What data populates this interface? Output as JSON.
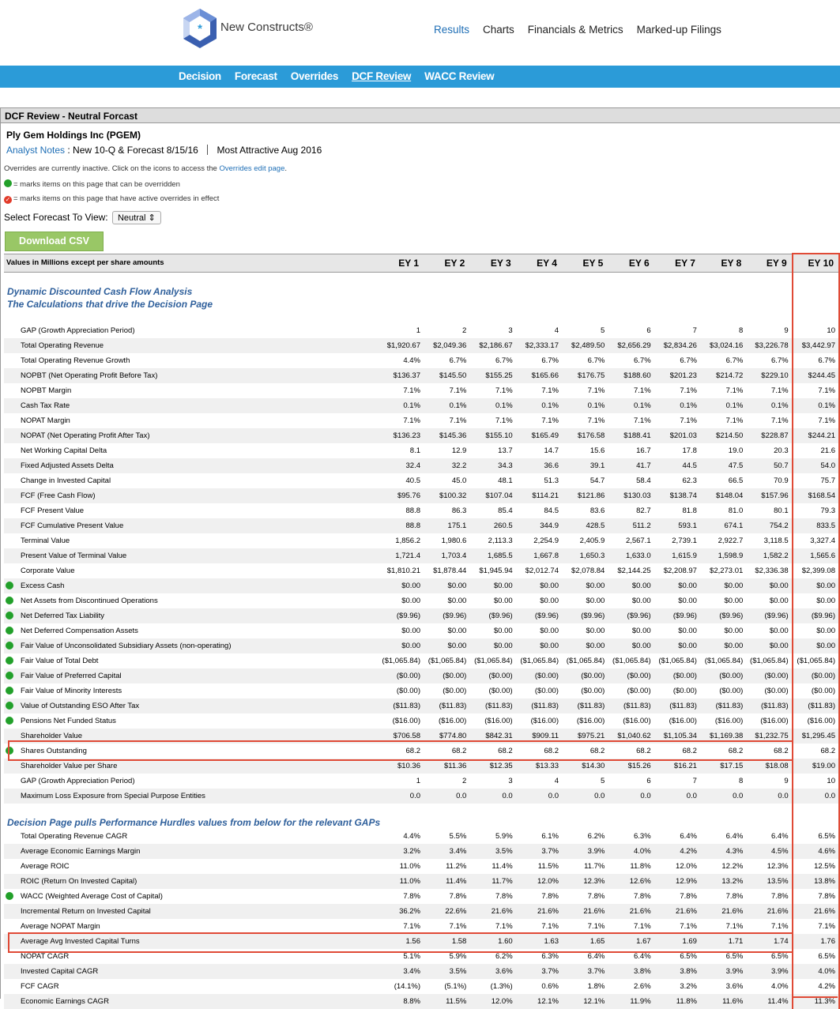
{
  "brand": {
    "name": "New Constructs®"
  },
  "topnav": [
    "Results",
    "Charts",
    "Financials & Metrics",
    "Marked-up Filings"
  ],
  "subnav": [
    "Decision",
    "Forecast",
    "Overrides",
    "DCF Review",
    "WACC Review"
  ],
  "panel": {
    "title": "DCF Review - Neutral Forcast",
    "company": "Ply Gem Holdings Inc (PGEM)",
    "notes_link": "Analyst Notes",
    "notes_text": ": New 10-Q & Forecast 8/15/16",
    "notes_right": "Most Attractive Aug 2016",
    "overrides_prefix": "Overrides are currently inactive. Click on the icons to access the ",
    "overrides_link": "Overrides edit page",
    "legend_green": "= marks items on this page that can be overridden",
    "legend_red": "= marks items on this page that have active overrides in effect",
    "select_label": "Select Forecast To View:",
    "select_value": "Neutral",
    "csv_button": "Download CSV"
  },
  "table": {
    "header": "Values in Millions except per share amounts",
    "columns": [
      "EY 1",
      "EY 2",
      "EY 3",
      "EY 4",
      "EY 5",
      "EY 6",
      "EY 7",
      "EY 8",
      "EY 9",
      "EY 10"
    ],
    "section1": [
      "Dynamic Discounted Cash Flow Analysis",
      "The Calculations that drive the Decision Page"
    ],
    "section2": "Decision Page pulls Performance Hurdles values from below for the relevant GAPs",
    "rows1": [
      {
        "label": "GAP (Growth Appreciation Period)",
        "dot": false,
        "values": [
          "1",
          "2",
          "3",
          "4",
          "5",
          "6",
          "7",
          "8",
          "9",
          "10"
        ]
      },
      {
        "label": "Total Operating Revenue",
        "dot": false,
        "values": [
          "$1,920.67",
          "$2,049.36",
          "$2,186.67",
          "$2,333.17",
          "$2,489.50",
          "$2,656.29",
          "$2,834.26",
          "$3,024.16",
          "$3,226.78",
          "$3,442.97"
        ]
      },
      {
        "label": "Total Operating Revenue Growth",
        "dot": false,
        "values": [
          "4.4%",
          "6.7%",
          "6.7%",
          "6.7%",
          "6.7%",
          "6.7%",
          "6.7%",
          "6.7%",
          "6.7%",
          "6.7%"
        ]
      },
      {
        "label": "NOPBT (Net Operating Profit Before Tax)",
        "dot": false,
        "values": [
          "$136.37",
          "$145.50",
          "$155.25",
          "$165.66",
          "$176.75",
          "$188.60",
          "$201.23",
          "$214.72",
          "$229.10",
          "$244.45"
        ]
      },
      {
        "label": "NOPBT Margin",
        "dot": false,
        "values": [
          "7.1%",
          "7.1%",
          "7.1%",
          "7.1%",
          "7.1%",
          "7.1%",
          "7.1%",
          "7.1%",
          "7.1%",
          "7.1%"
        ]
      },
      {
        "label": "Cash Tax Rate",
        "dot": false,
        "values": [
          "0.1%",
          "0.1%",
          "0.1%",
          "0.1%",
          "0.1%",
          "0.1%",
          "0.1%",
          "0.1%",
          "0.1%",
          "0.1%"
        ]
      },
      {
        "label": "NOPAT Margin",
        "dot": false,
        "values": [
          "7.1%",
          "7.1%",
          "7.1%",
          "7.1%",
          "7.1%",
          "7.1%",
          "7.1%",
          "7.1%",
          "7.1%",
          "7.1%"
        ]
      },
      {
        "label": "NOPAT (Net Operating Profit After Tax)",
        "dot": false,
        "values": [
          "$136.23",
          "$145.36",
          "$155.10",
          "$165.49",
          "$176.58",
          "$188.41",
          "$201.03",
          "$214.50",
          "$228.87",
          "$244.21"
        ]
      },
      {
        "label": "Net Working Capital Delta",
        "dot": false,
        "values": [
          "8.1",
          "12.9",
          "13.7",
          "14.7",
          "15.6",
          "16.7",
          "17.8",
          "19.0",
          "20.3",
          "21.6"
        ]
      },
      {
        "label": "Fixed Adjusted Assets Delta",
        "dot": false,
        "values": [
          "32.4",
          "32.2",
          "34.3",
          "36.6",
          "39.1",
          "41.7",
          "44.5",
          "47.5",
          "50.7",
          "54.0"
        ]
      },
      {
        "label": "Change in Invested Capital",
        "dot": false,
        "values": [
          "40.5",
          "45.0",
          "48.1",
          "51.3",
          "54.7",
          "58.4",
          "62.3",
          "66.5",
          "70.9",
          "75.7"
        ]
      },
      {
        "label": "FCF (Free Cash Flow)",
        "dot": false,
        "values": [
          "$95.76",
          "$100.32",
          "$107.04",
          "$114.21",
          "$121.86",
          "$130.03",
          "$138.74",
          "$148.04",
          "$157.96",
          "$168.54"
        ]
      },
      {
        "label": "FCF Present Value",
        "dot": false,
        "values": [
          "88.8",
          "86.3",
          "85.4",
          "84.5",
          "83.6",
          "82.7",
          "81.8",
          "81.0",
          "80.1",
          "79.3"
        ]
      },
      {
        "label": "FCF Cumulative Present Value",
        "dot": false,
        "values": [
          "88.8",
          "175.1",
          "260.5",
          "344.9",
          "428.5",
          "511.2",
          "593.1",
          "674.1",
          "754.2",
          "833.5"
        ]
      },
      {
        "label": "Terminal Value",
        "dot": false,
        "values": [
          "1,856.2",
          "1,980.6",
          "2,113.3",
          "2,254.9",
          "2,405.9",
          "2,567.1",
          "2,739.1",
          "2,922.7",
          "3,118.5",
          "3,327.4"
        ]
      },
      {
        "label": "Present Value of Terminal Value",
        "dot": false,
        "values": [
          "1,721.4",
          "1,703.4",
          "1,685.5",
          "1,667.8",
          "1,650.3",
          "1,633.0",
          "1,615.9",
          "1,598.9",
          "1,582.2",
          "1,565.6"
        ]
      },
      {
        "label": "Corporate Value",
        "dot": false,
        "values": [
          "$1,810.21",
          "$1,878.44",
          "$1,945.94",
          "$2,012.74",
          "$2,078.84",
          "$2,144.25",
          "$2,208.97",
          "$2,273.01",
          "$2,336.38",
          "$2,399.08"
        ]
      },
      {
        "label": "Excess Cash",
        "dot": true,
        "values": [
          "$0.00",
          "$0.00",
          "$0.00",
          "$0.00",
          "$0.00",
          "$0.00",
          "$0.00",
          "$0.00",
          "$0.00",
          "$0.00"
        ]
      },
      {
        "label": "Net Assets from Discontinued Operations",
        "dot": true,
        "values": [
          "$0.00",
          "$0.00",
          "$0.00",
          "$0.00",
          "$0.00",
          "$0.00",
          "$0.00",
          "$0.00",
          "$0.00",
          "$0.00"
        ]
      },
      {
        "label": "Net Deferred Tax Liability",
        "dot": true,
        "values": [
          "($9.96)",
          "($9.96)",
          "($9.96)",
          "($9.96)",
          "($9.96)",
          "($9.96)",
          "($9.96)",
          "($9.96)",
          "($9.96)",
          "($9.96)"
        ]
      },
      {
        "label": "Net Deferred Compensation Assets",
        "dot": true,
        "values": [
          "$0.00",
          "$0.00",
          "$0.00",
          "$0.00",
          "$0.00",
          "$0.00",
          "$0.00",
          "$0.00",
          "$0.00",
          "$0.00"
        ]
      },
      {
        "label": "Fair Value of Unconsolidated Subsidiary Assets (non-operating)",
        "dot": true,
        "values": [
          "$0.00",
          "$0.00",
          "$0.00",
          "$0.00",
          "$0.00",
          "$0.00",
          "$0.00",
          "$0.00",
          "$0.00",
          "$0.00"
        ]
      },
      {
        "label": "Fair Value of Total Debt",
        "dot": true,
        "values": [
          "($1,065.84)",
          "($1,065.84)",
          "($1,065.84)",
          "($1,065.84)",
          "($1,065.84)",
          "($1,065.84)",
          "($1,065.84)",
          "($1,065.84)",
          "($1,065.84)",
          "($1,065.84)"
        ]
      },
      {
        "label": "Fair Value of Preferred Capital",
        "dot": true,
        "values": [
          "($0.00)",
          "($0.00)",
          "($0.00)",
          "($0.00)",
          "($0.00)",
          "($0.00)",
          "($0.00)",
          "($0.00)",
          "($0.00)",
          "($0.00)"
        ]
      },
      {
        "label": "Fair Value of Minority Interests",
        "dot": true,
        "values": [
          "($0.00)",
          "($0.00)",
          "($0.00)",
          "($0.00)",
          "($0.00)",
          "($0.00)",
          "($0.00)",
          "($0.00)",
          "($0.00)",
          "($0.00)"
        ]
      },
      {
        "label": "Value of Outstanding ESO After Tax",
        "dot": true,
        "values": [
          "($11.83)",
          "($11.83)",
          "($11.83)",
          "($11.83)",
          "($11.83)",
          "($11.83)",
          "($11.83)",
          "($11.83)",
          "($11.83)",
          "($11.83)"
        ]
      },
      {
        "label": "Pensions Net Funded Status",
        "dot": true,
        "values": [
          "($16.00)",
          "($16.00)",
          "($16.00)",
          "($16.00)",
          "($16.00)",
          "($16.00)",
          "($16.00)",
          "($16.00)",
          "($16.00)",
          "($16.00)"
        ]
      },
      {
        "label": "Shareholder Value",
        "dot": false,
        "values": [
          "$706.58",
          "$774.80",
          "$842.31",
          "$909.11",
          "$975.21",
          "$1,040.62",
          "$1,105.34",
          "$1,169.38",
          "$1,232.75",
          "$1,295.45"
        ]
      },
      {
        "label": "Shares Outstanding",
        "dot": true,
        "values": [
          "68.2",
          "68.2",
          "68.2",
          "68.2",
          "68.2",
          "68.2",
          "68.2",
          "68.2",
          "68.2",
          "68.2"
        ]
      },
      {
        "label": "Shareholder Value per Share",
        "dot": false,
        "values": [
          "$10.36",
          "$11.36",
          "$12.35",
          "$13.33",
          "$14.30",
          "$15.26",
          "$16.21",
          "$17.15",
          "$18.08",
          "$19.00"
        ]
      },
      {
        "label": "GAP (Growth Appreciation Period)",
        "dot": false,
        "values": [
          "1",
          "2",
          "3",
          "4",
          "5",
          "6",
          "7",
          "8",
          "9",
          "10"
        ]
      },
      {
        "label": "Maximum Loss Exposure from Special Purpose Entities",
        "dot": false,
        "values": [
          "0.0",
          "0.0",
          "0.0",
          "0.0",
          "0.0",
          "0.0",
          "0.0",
          "0.0",
          "0.0",
          "0.0"
        ]
      }
    ],
    "rows2": [
      {
        "label": "Total Operating Revenue CAGR",
        "dot": false,
        "values": [
          "4.4%",
          "5.5%",
          "5.9%",
          "6.1%",
          "6.2%",
          "6.3%",
          "6.4%",
          "6.4%",
          "6.4%",
          "6.5%"
        ]
      },
      {
        "label": "Average Economic Earnings Margin",
        "dot": false,
        "values": [
          "3.2%",
          "3.4%",
          "3.5%",
          "3.7%",
          "3.9%",
          "4.0%",
          "4.2%",
          "4.3%",
          "4.5%",
          "4.6%"
        ]
      },
      {
        "label": "Average ROIC",
        "dot": false,
        "values": [
          "11.0%",
          "11.2%",
          "11.4%",
          "11.5%",
          "11.7%",
          "11.8%",
          "12.0%",
          "12.2%",
          "12.3%",
          "12.5%"
        ]
      },
      {
        "label": "ROIC (Return On Invested Capital)",
        "dot": false,
        "values": [
          "11.0%",
          "11.4%",
          "11.7%",
          "12.0%",
          "12.3%",
          "12.6%",
          "12.9%",
          "13.2%",
          "13.5%",
          "13.8%"
        ]
      },
      {
        "label": "WACC (Weighted Average Cost of Capital)",
        "dot": true,
        "values": [
          "7.8%",
          "7.8%",
          "7.8%",
          "7.8%",
          "7.8%",
          "7.8%",
          "7.8%",
          "7.8%",
          "7.8%",
          "7.8%"
        ]
      },
      {
        "label": "Incremental Return on Invested Capital",
        "dot": false,
        "values": [
          "36.2%",
          "22.6%",
          "21.6%",
          "21.6%",
          "21.6%",
          "21.6%",
          "21.6%",
          "21.6%",
          "21.6%",
          "21.6%"
        ]
      },
      {
        "label": "Average NOPAT Margin",
        "dot": false,
        "values": [
          "7.1%",
          "7.1%",
          "7.1%",
          "7.1%",
          "7.1%",
          "7.1%",
          "7.1%",
          "7.1%",
          "7.1%",
          "7.1%"
        ]
      },
      {
        "label": "Average Avg Invested Capital Turns",
        "dot": false,
        "values": [
          "1.56",
          "1.58",
          "1.60",
          "1.63",
          "1.65",
          "1.67",
          "1.69",
          "1.71",
          "1.74",
          "1.76"
        ]
      },
      {
        "label": "NOPAT CAGR",
        "dot": false,
        "values": [
          "5.1%",
          "5.9%",
          "6.2%",
          "6.3%",
          "6.4%",
          "6.4%",
          "6.5%",
          "6.5%",
          "6.5%",
          "6.5%"
        ]
      },
      {
        "label": "Invested Capital CAGR",
        "dot": false,
        "values": [
          "3.4%",
          "3.5%",
          "3.6%",
          "3.7%",
          "3.7%",
          "3.8%",
          "3.8%",
          "3.9%",
          "3.9%",
          "4.0%"
        ]
      },
      {
        "label": "FCF CAGR",
        "dot": false,
        "values": [
          "(14.1%)",
          "(5.1%)",
          "(1.3%)",
          "0.6%",
          "1.8%",
          "2.6%",
          "3.2%",
          "3.6%",
          "4.0%",
          "4.2%"
        ]
      },
      {
        "label": "Economic Earnings CAGR",
        "dot": false,
        "values": [
          "8.8%",
          "11.5%",
          "12.0%",
          "12.1%",
          "12.1%",
          "11.9%",
          "11.8%",
          "11.6%",
          "11.4%",
          "11.3%"
        ]
      }
    ]
  }
}
